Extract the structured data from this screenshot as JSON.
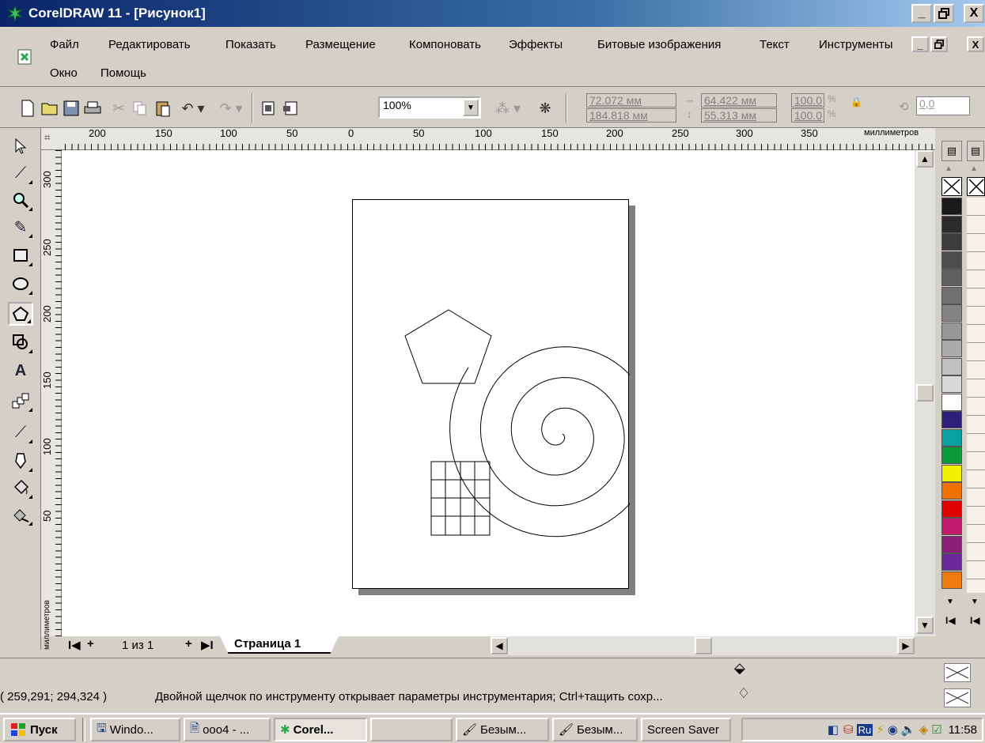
{
  "window": {
    "title": "CorelDRAW 11 - [Рисунок1]",
    "minimize": "_",
    "maximize": "🗗",
    "close": "X"
  },
  "menu": {
    "items": [
      {
        "label": "Файл"
      },
      {
        "label": "Редактировать"
      },
      {
        "label": "Показать"
      },
      {
        "label": "Размещение"
      },
      {
        "label": "Компоновать"
      },
      {
        "label": "Эффекты"
      },
      {
        "label": "Битовые изображения"
      },
      {
        "label": "Текст"
      },
      {
        "label": "Инструменты"
      },
      {
        "label": "Окно"
      },
      {
        "label": "Помощь"
      }
    ]
  },
  "toolbar": {
    "zoom": "100%",
    "pos_x": "72.072 мм",
    "pos_y": "184.818 мм",
    "width": "64.422 мм",
    "height": "55.313 мм",
    "scale_x": "100.0",
    "scale_y": "100.0",
    "percent": "%",
    "rotation": "0,0"
  },
  "rulers": {
    "h_labels": [
      "200",
      "150",
      "100",
      "50",
      "0",
      "50",
      "100",
      "150",
      "200",
      "250",
      "300",
      "350"
    ],
    "h_unit": "миллиметров",
    "v_labels": [
      "300",
      "250",
      "200",
      "150",
      "100",
      "50"
    ],
    "v_unit": "миллиметров"
  },
  "page_nav": {
    "first": "I◀",
    "add_before": "+",
    "counter": "1 из 1",
    "add_after": "+",
    "last": "▶I",
    "tab": "Страница 1"
  },
  "palette": {
    "colors": [
      "#1a1a1a",
      "#2b2b2b",
      "#3c3c3c",
      "#4d4d4d",
      "#5f5f5f",
      "#707070",
      "#838383",
      "#979797",
      "#ababab",
      "#c0c0c0",
      "#d8d8d8",
      "#ffffff",
      "#2e1f7a",
      "#0aa0a0",
      "#0a9a3a",
      "#f0f000",
      "#f07000",
      "#e00000",
      "#c01a6a",
      "#8a1f7a",
      "#6a2a9a",
      "#f07a10"
    ]
  },
  "status": {
    "coords": "( 259,291; 294,324 )",
    "hint": "Двойной щелчок по инструменту открывает параметры инструментария; Ctrl+тащить сохр..."
  },
  "taskbar": {
    "start": "Пуск",
    "tasks": [
      {
        "label": "Windo..."
      },
      {
        "label": "ооо4 - ..."
      },
      {
        "label": "Corel..."
      },
      {
        "label": ""
      },
      {
        "label": "Безым..."
      },
      {
        "label": "Безым..."
      },
      {
        "label": "Screen Saver"
      }
    ],
    "lang": "Ru",
    "clock": "11:58"
  }
}
